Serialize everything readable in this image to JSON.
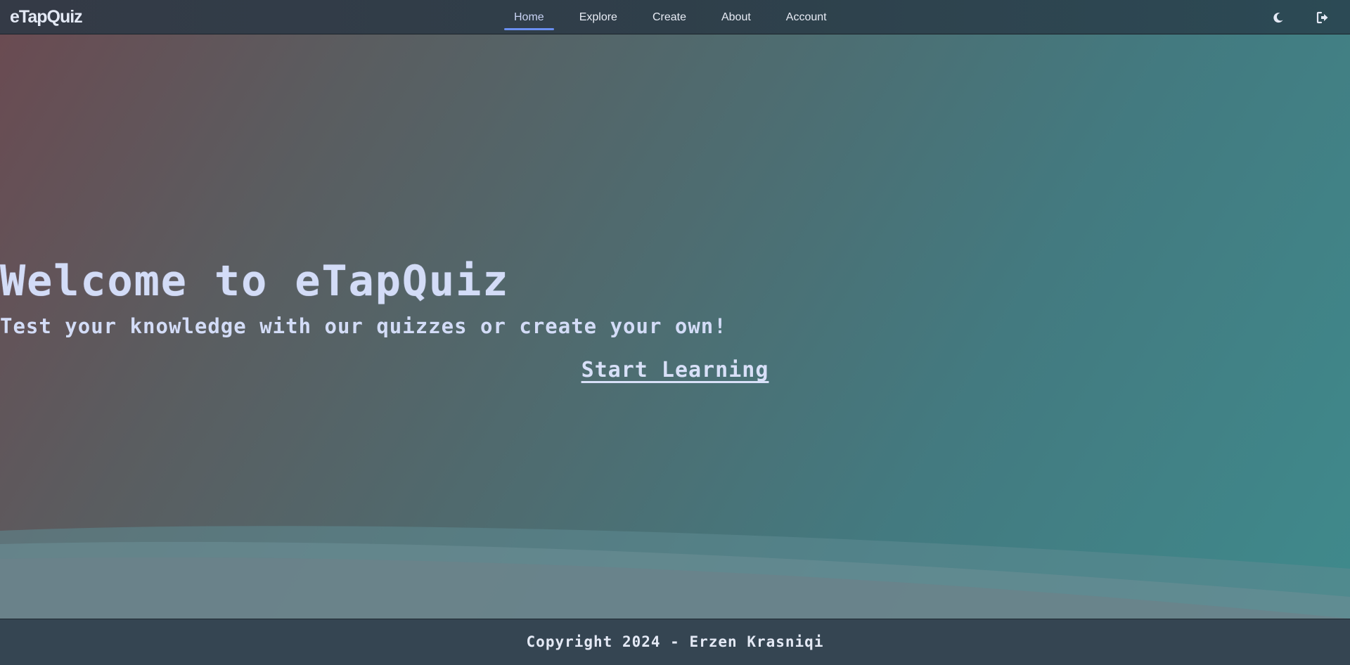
{
  "brand": {
    "name": "eTapQuiz"
  },
  "nav": {
    "items": [
      {
        "label": "Home",
        "active": true
      },
      {
        "label": "Explore",
        "active": false
      },
      {
        "label": "Create",
        "active": false
      },
      {
        "label": "About",
        "active": false
      },
      {
        "label": "Account",
        "active": false
      }
    ],
    "icons": [
      "moon-icon",
      "logout-icon"
    ]
  },
  "hero": {
    "title": "Welcome to eTapQuiz",
    "subtitle": "Test your knowledge with our quizzes or create your own!",
    "cta_label": "Start Learning"
  },
  "footer": {
    "text": "Copyright 2024 - Erzen Krasniqi"
  },
  "colors": {
    "accent": "#6a8ff0",
    "text_light": "#d3dcf7",
    "footer_bg": "#354552"
  }
}
